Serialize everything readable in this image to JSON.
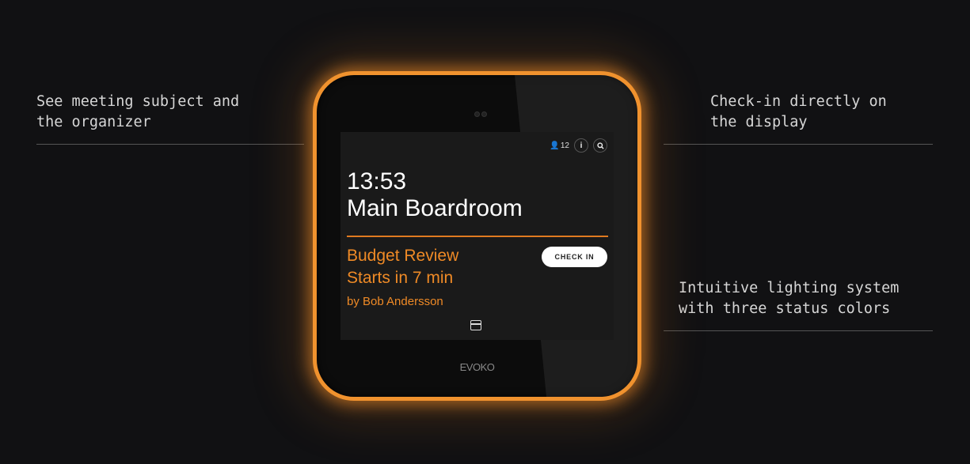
{
  "features": [
    {
      "text": "See meeting subject and\nthe organizer"
    },
    {
      "text": "Check-in directly on\nthe display"
    },
    {
      "text": "Intuitive lighting system\nwith three status colors"
    }
  ],
  "device": {
    "brand": "EVOKO",
    "accent_color": "#f0922e",
    "screen": {
      "attendees": "12",
      "time": "13:53",
      "room": "Main Boardroom",
      "meeting_subject": "Budget Review",
      "meeting_status": "Starts in 7 min",
      "organizer": "by Bob Andersson",
      "check_in_label": "CHECK IN"
    }
  }
}
